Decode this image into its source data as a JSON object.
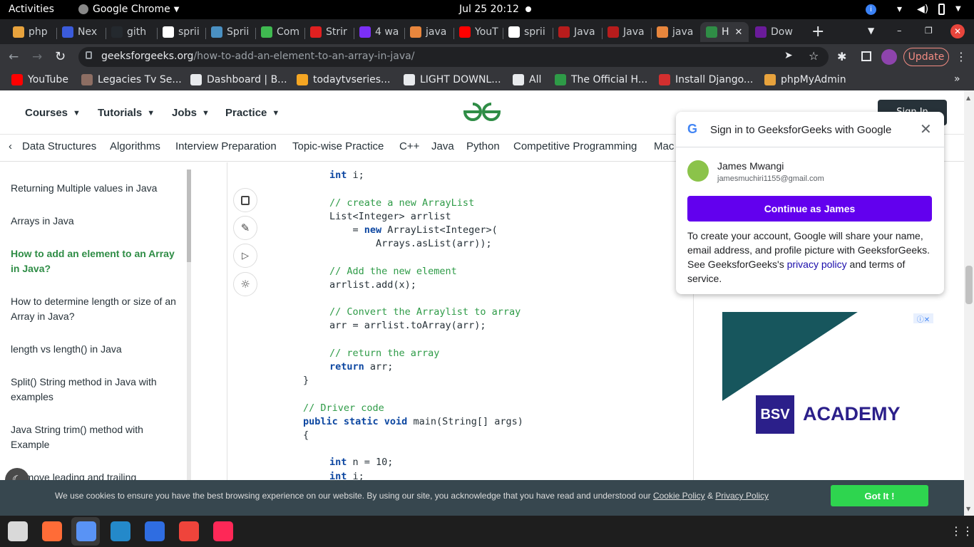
{
  "system_bar": {
    "activities": "Activities",
    "app_name": "Google Chrome",
    "datetime": "Jul 25  20:12"
  },
  "tabs": [
    {
      "label": "php",
      "color": "#e8a33d"
    },
    {
      "label": "Nex",
      "color": "#3b5bdb"
    },
    {
      "label": "gith",
      "color": "#24292e"
    },
    {
      "label": "sprii",
      "color": "#ffffff"
    },
    {
      "label": "Sprii",
      "color": "#4a90c2"
    },
    {
      "label": "Com",
      "color": "#3fb950"
    },
    {
      "label": "Strir",
      "color": "#e02020"
    },
    {
      "label": "4 wa",
      "color": "#7b2ff7"
    },
    {
      "label": "java",
      "color": "#e8863d"
    },
    {
      "label": "YouT",
      "color": "#ff0000"
    },
    {
      "label": "sprii",
      "color": "#ffffff"
    },
    {
      "label": "Java",
      "color": "#b71c1c"
    },
    {
      "label": "Java",
      "color": "#b71c1c"
    },
    {
      "label": "java",
      "color": "#e8863d"
    },
    {
      "label": "H",
      "color": "#2f8d46"
    },
    {
      "label": "Dow",
      "color": "#6a1b9a"
    }
  ],
  "toolbar": {
    "url_host": "geeksforgeeks.org",
    "url_path": "/how-to-add-an-element-to-an-array-in-java/",
    "update_label": "Update"
  },
  "bookmarks": [
    {
      "label": "YouTube",
      "color": "#ff0000"
    },
    {
      "label": "Legacies Tv Se...",
      "color": "#8d6e63"
    },
    {
      "label": "Dashboard | B...",
      "color": "#e8eaed"
    },
    {
      "label": "todaytvseries...",
      "color": "#f5a623"
    },
    {
      "label": "LIGHT DOWNL...",
      "color": "#e8eaed"
    },
    {
      "label": "All",
      "color": "#e8eaed"
    },
    {
      "label": "The Official H...",
      "color": "#2e9b47"
    },
    {
      "label": "Install Django...",
      "color": "#d32f2f"
    },
    {
      "label": "phpMyAdmin",
      "color": "#e8a33d"
    }
  ],
  "gfg": {
    "nav": [
      "Courses",
      "Tutorials",
      "Jobs",
      "Practice"
    ],
    "logo": "GG",
    "sign_in": "Sign In",
    "subnav": [
      "Data Structures",
      "Algorithms",
      "Interview Preparation",
      "Topic-wise Practice",
      "C++",
      "Java",
      "Python",
      "Competitive Programming",
      "Mac"
    ],
    "sidebar": [
      {
        "label": "Returning Multiple values in Java",
        "active": false
      },
      {
        "label": "Arrays in Java",
        "active": false
      },
      {
        "label": "How to add an element to an Array in Java?",
        "active": true
      },
      {
        "label": "How to determine length or size of an Array in Java?",
        "active": false
      },
      {
        "label": "length vs length() in Java",
        "active": false
      },
      {
        "label": "Split() String method in Java with examples",
        "active": false
      },
      {
        "label": "Java String trim() method with Example",
        "active": false
      },
      {
        "label": "'Remove leading and trailing",
        "active": false
      }
    ]
  },
  "code": [
    [
      {
        "t": "int",
        "c": "kw"
      },
      {
        "t": " i;"
      }
    ],
    [],
    [
      {
        "t": "// create a new ArrayList",
        "c": "cm"
      }
    ],
    [
      {
        "t": "List<Integer> arrlist"
      }
    ],
    [
      {
        "t": "    = "
      },
      {
        "t": "new",
        "c": "kw"
      },
      {
        "t": " ArrayList<Integer>("
      }
    ],
    [
      {
        "t": "        Arrays.asList(arr));"
      }
    ],
    [],
    [
      {
        "t": "// Add the new element",
        "c": "cm"
      }
    ],
    [
      {
        "t": "arrlist.add(x);"
      }
    ],
    [],
    [
      {
        "t": "// Convert the Arraylist to array",
        "c": "cm"
      }
    ],
    [
      {
        "t": "arr = arrlist.toArray(arr);"
      }
    ],
    [],
    [
      {
        "t": "// return the array",
        "c": "cm"
      }
    ],
    [
      {
        "t": "return",
        "c": "kw"
      },
      {
        "t": " arr;"
      }
    ],
    [
      {
        "t": "}"
      }
    ],
    [],
    [
      {
        "t": "// Driver code",
        "c": "cm"
      }
    ],
    [
      {
        "t": "public static void",
        "c": "kw"
      },
      {
        "t": " main(String[] args)"
      }
    ],
    [
      {
        "t": "{"
      }
    ],
    [],
    [
      {
        "t": "int",
        "c": "kw"
      },
      {
        "t": " n = 10;"
      }
    ],
    [
      {
        "t": "int",
        "c": "kw"
      },
      {
        "t": " i;"
      }
    ]
  ],
  "popup": {
    "title": "Sign in to GeeksforGeeks with Google",
    "user_name": "James Mwangi",
    "user_email": "jamesmuchiri1155@gmail.com",
    "continue_label": "Continue as James",
    "body_pre": "To create your account, Google will share your name, email address, and profile picture with GeeksforGeeks. See GeeksforGeeks's ",
    "privacy_link": "privacy policy",
    "body_post": " and terms of service."
  },
  "ad": {
    "badge": "BSV",
    "text": "ACADEMY"
  },
  "cookie": {
    "text": "We use cookies to ensure you have the best browsing experience on our website. By using our site, you acknowledge that you have read and understood our ",
    "cookie_policy": "Cookie Policy",
    "amp": " & ",
    "privacy_policy": "Privacy Policy",
    "button": "Got It !"
  },
  "dock": [
    {
      "name": "files",
      "color": "#d9d9d9"
    },
    {
      "name": "postman",
      "color": "#ff6c37"
    },
    {
      "name": "chrome",
      "color": "#4285f4"
    },
    {
      "name": "vscode",
      "color": "#2489ca"
    },
    {
      "name": "wps",
      "color": "#2f6de1"
    },
    {
      "name": "anydesk",
      "color": "#ef443b"
    },
    {
      "name": "intellij",
      "color": "#fe2857"
    }
  ]
}
